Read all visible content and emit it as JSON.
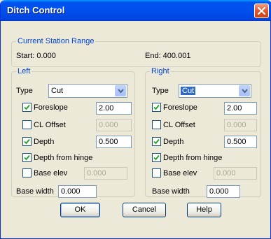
{
  "window": {
    "title": "Ditch Control"
  },
  "station": {
    "group_title": "Current Station Range",
    "start": "Start: 0.000",
    "end": "End: 400.001"
  },
  "left": {
    "group_title": "Left",
    "type_label": "Type",
    "type_value": "Cut",
    "foreslope": {
      "label": "Foreslope",
      "checked": true,
      "value": "2.00"
    },
    "cl_offset": {
      "label": "CL Offset",
      "checked": false,
      "value": "0.000"
    },
    "depth": {
      "label": "Depth",
      "checked": true,
      "value": "0.500"
    },
    "depth_from_hinge": {
      "label": "Depth from hinge",
      "checked": true
    },
    "base_elev": {
      "label": "Base elev",
      "checked": false,
      "value": "0.000"
    },
    "base_width": {
      "label": "Base width",
      "value": "0.000"
    }
  },
  "right": {
    "group_title": "Right",
    "type_label": "Type",
    "type_value": "Cut",
    "foreslope": {
      "label": "Foreslope",
      "checked": true,
      "value": "2.00"
    },
    "cl_offset": {
      "label": "CL Offset",
      "checked": false,
      "value": "0.000"
    },
    "depth": {
      "label": "Depth",
      "checked": true,
      "value": "0.500"
    },
    "depth_from_hinge": {
      "label": "Depth from hinge",
      "checked": true
    },
    "base_elev": {
      "label": "Base elev",
      "checked": false,
      "value": "0.000"
    },
    "base_width": {
      "label": "Base width",
      "value": "0.000"
    }
  },
  "buttons": {
    "ok": "OK",
    "cancel": "Cancel",
    "help": "Help"
  },
  "icons": {
    "close": "close-icon",
    "check": "checkmark-icon",
    "dropdown": "chevron-down-icon"
  }
}
